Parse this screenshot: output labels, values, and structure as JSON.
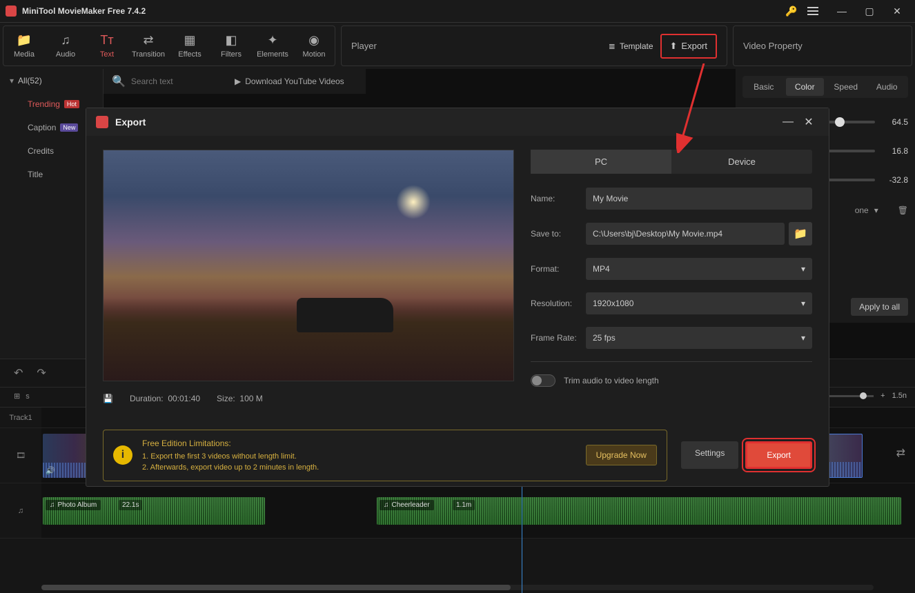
{
  "titlebar": {
    "title": "MiniTool MovieMaker Free 7.4.2"
  },
  "toolbar": {
    "media": "Media",
    "audio": "Audio",
    "text": "Text",
    "transition": "Transition",
    "effects": "Effects",
    "filters": "Filters",
    "elements": "Elements",
    "motion": "Motion"
  },
  "player": {
    "title": "Player",
    "template": "Template",
    "export": "Export"
  },
  "video_property": {
    "title": "Video Property",
    "tabs": {
      "basic": "Basic",
      "color": "Color",
      "speed": "Speed",
      "audio": "Audio"
    },
    "v1": "64.5",
    "v2": "16.8",
    "v3": "-32.8",
    "none": "one",
    "apply_all": "Apply to all"
  },
  "sidebar": {
    "all": "All(52)",
    "items": [
      {
        "label": "Trending",
        "badge": "Hot"
      },
      {
        "label": "Caption",
        "badge": "New"
      },
      {
        "label": "Credits"
      },
      {
        "label": "Title"
      }
    ]
  },
  "search": {
    "placeholder": "Search text"
  },
  "download_yt": "Download YouTube Videos",
  "timeline": {
    "track1": "Track1",
    "end_time": "1.5n",
    "s_label": "s",
    "audio1": {
      "name": "Photo Album",
      "dur": "22.1s"
    },
    "audio2": {
      "name": "Cheerleader",
      "dur": "1.1m"
    }
  },
  "export_dialog": {
    "title": "Export",
    "tabs": {
      "pc": "PC",
      "device": "Device"
    },
    "name_label": "Name:",
    "name_value": "My Movie",
    "saveto_label": "Save to:",
    "saveto_value": "C:\\Users\\bj\\Desktop\\My Movie.mp4",
    "format_label": "Format:",
    "format_value": "MP4",
    "resolution_label": "Resolution:",
    "resolution_value": "1920x1080",
    "framerate_label": "Frame Rate:",
    "framerate_value": "25 fps",
    "trim_label": "Trim audio to video length",
    "duration_label": "Duration:",
    "duration_value": "00:01:40",
    "size_label": "Size:",
    "size_value": "100 M",
    "limitations": {
      "title": "Free Edition Limitations:",
      "line1": "1. Export the first 3 videos without length limit.",
      "line2": "2. Afterwards, export video up to 2 minutes in length."
    },
    "upgrade": "Upgrade Now",
    "settings": "Settings",
    "export": "Export"
  }
}
